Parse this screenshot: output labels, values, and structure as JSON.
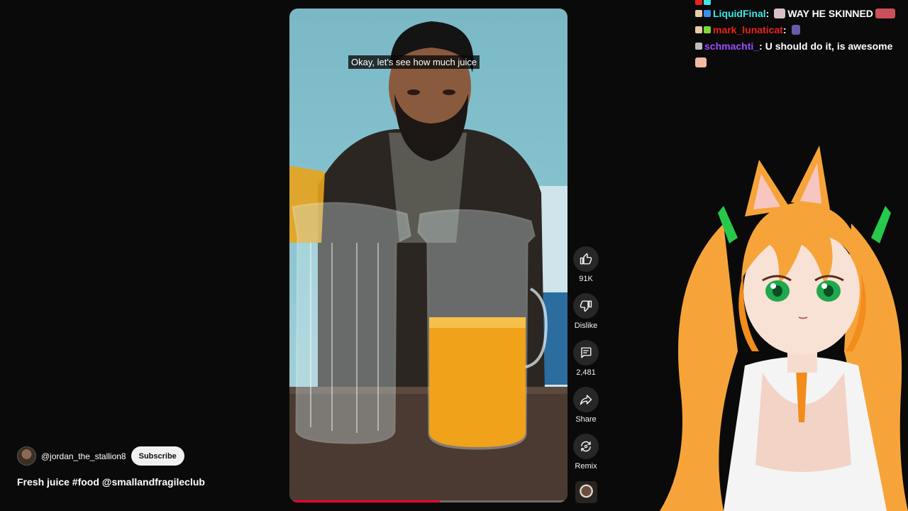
{
  "video": {
    "caption": "Okay, let's see how much juice",
    "progress_percent": 54
  },
  "channel": {
    "handle": "@jordan_the_stallion8",
    "subscribe_label": "Subscribe",
    "title": "Fresh juice #food @smallandfragileclub"
  },
  "actions": {
    "like_count": "91K",
    "dislike_label": "Dislike",
    "comment_count": "2,481",
    "share_label": "Share",
    "remix_label": "Remix"
  },
  "chat": {
    "messages": [
      {
        "user": "LiquidFinal",
        "user_color": "#3ee8e8",
        "text": "WAY HE SKINNED"
      },
      {
        "user": "mark_lunaticat",
        "user_color": "#e8231a",
        "text": ""
      },
      {
        "user": "schmachti_",
        "user_color": "#9b4dff",
        "text": "U should do it, is awesome"
      }
    ]
  },
  "colors": {
    "background": "#0a0a0a",
    "accent_progress": "#ff0033",
    "button_bg": "#272727",
    "subscribe_bg": "#f1f1f1"
  },
  "icons": [
    "thumb-up-icon",
    "thumb-down-icon",
    "comment-icon",
    "share-icon",
    "remix-icon"
  ]
}
